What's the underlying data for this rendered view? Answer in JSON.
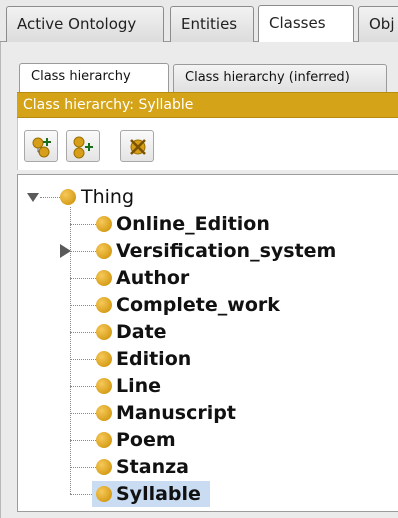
{
  "top_tabs": [
    {
      "label": "Active Ontology",
      "active": false
    },
    {
      "label": "Entities",
      "active": false
    },
    {
      "label": "Classes",
      "active": true
    },
    {
      "label": "Obj",
      "active": false
    }
  ],
  "sub_tabs": [
    {
      "label": "Class hierarchy",
      "active": true
    },
    {
      "label": "Class hierarchy (inferred)",
      "active": false
    }
  ],
  "view_header": "Class hierarchy: Syllable",
  "toolbar": {
    "buttons": [
      {
        "icon": "add-subclass-icon"
      },
      {
        "icon": "add-sibling-class-icon"
      },
      {
        "icon": "delete-class-icon"
      }
    ]
  },
  "tree": {
    "root": {
      "label": "Thing",
      "expanded": true
    },
    "children": [
      {
        "label": "Online_Edition",
        "has_children": false,
        "selected": false
      },
      {
        "label": "Versification_system",
        "has_children": true,
        "selected": false
      },
      {
        "label": "Author",
        "has_children": false,
        "selected": false
      },
      {
        "label": "Complete_work",
        "has_children": false,
        "selected": false
      },
      {
        "label": "Date",
        "has_children": false,
        "selected": false
      },
      {
        "label": "Edition",
        "has_children": false,
        "selected": false
      },
      {
        "label": "Line",
        "has_children": false,
        "selected": false
      },
      {
        "label": "Manuscript",
        "has_children": false,
        "selected": false
      },
      {
        "label": "Poem",
        "has_children": false,
        "selected": false
      },
      {
        "label": "Stanza",
        "has_children": false,
        "selected": false
      },
      {
        "label": "Syllable",
        "has_children": false,
        "selected": true
      }
    ]
  },
  "colors": {
    "header_bg": "#d4a317",
    "selection_bg": "#c9dcf2",
    "class_bullet": "#d79e1a"
  }
}
